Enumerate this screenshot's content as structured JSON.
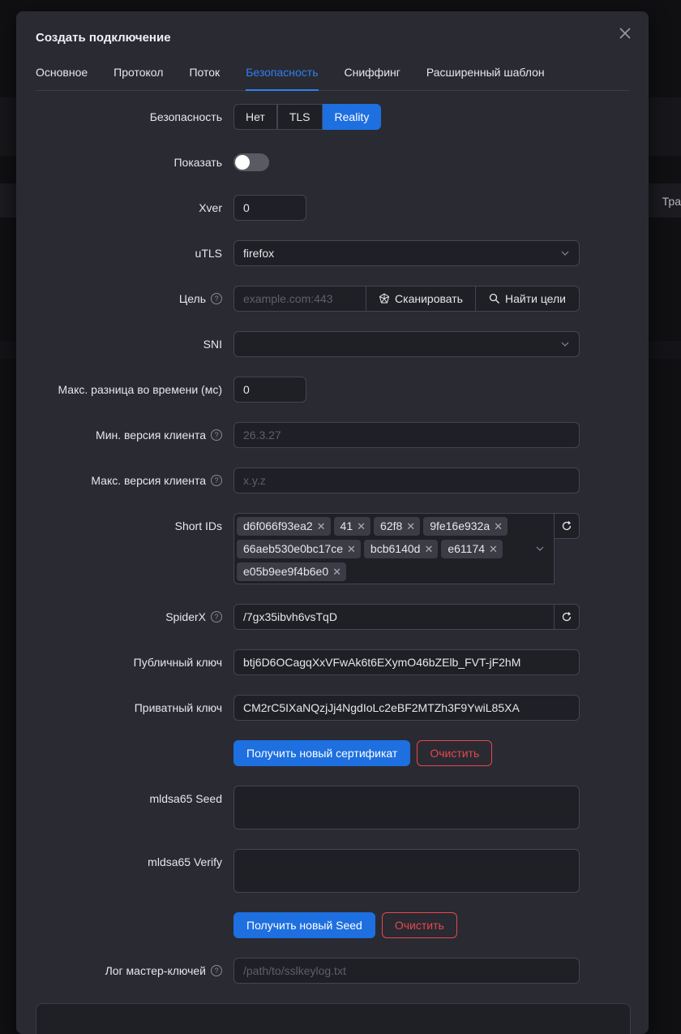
{
  "background": {
    "column_header_partial": "Тра"
  },
  "dialog": {
    "title": "Создать подключение",
    "tabs": [
      "Основное",
      "Протокол",
      "Поток",
      "Безопасность",
      "Сниффинг",
      "Расширенный шаблон"
    ],
    "active_tab": "Безопасность"
  },
  "form": {
    "security": {
      "label": "Безопасность",
      "options": [
        "Нет",
        "TLS",
        "Reality"
      ],
      "selected": "Reality"
    },
    "show": {
      "label": "Показать",
      "checked": false
    },
    "xver": {
      "label": "Xver",
      "value": "0"
    },
    "utls": {
      "label": "uTLS",
      "value": "firefox"
    },
    "target": {
      "label": "Цель",
      "placeholder": "example.com:443",
      "scan_label": "Сканировать",
      "find_label": "Найти цели"
    },
    "sni": {
      "label": "SNI",
      "value": ""
    },
    "max_time_diff": {
      "label": "Макс. разница во времени (мс)",
      "value": "0"
    },
    "min_client": {
      "label": "Мин. версия клиента",
      "placeholder": "26.3.27"
    },
    "max_client": {
      "label": "Макс. версия клиента",
      "placeholder": "x.y.z"
    },
    "short_ids": {
      "label": "Short IDs",
      "values": [
        "d6f066f93ea2",
        "41",
        "62f8",
        "9fe16e932a",
        "66aeb530e0bc17ce",
        "bcb6140d",
        "e61174",
        "e05b9ee9f4b6e0"
      ]
    },
    "spiderx": {
      "label": "SpiderX",
      "value": "/7gx35ibvh6vsTqD"
    },
    "public_key": {
      "label": "Публичный ключ",
      "value": "btj6D6OCagqXxVFwAk6t6EXymO46bZElb_FVT-jF2hM"
    },
    "private_key": {
      "label": "Приватный ключ",
      "value": "CM2rC5IXaNQzjJj4NgdIoLc2eBF2MTZh3F9YwiL85XA"
    },
    "cert_buttons": {
      "new": "Получить новый сертификат",
      "clear": "Очистить"
    },
    "mldsa_seed": {
      "label": "mldsa65 Seed",
      "value": ""
    },
    "mldsa_verify": {
      "label": "mldsa65 Verify",
      "value": ""
    },
    "seed_buttons": {
      "new": "Получить новый Seed",
      "clear": "Очистить"
    },
    "keylog": {
      "label": "Лог мастер-ключей",
      "placeholder": "/path/to/sslkeylog.txt"
    }
  },
  "colors": {
    "accent": "#1e6fe0",
    "danger": "#e5484d",
    "modal_bg": "#2a2a33"
  }
}
